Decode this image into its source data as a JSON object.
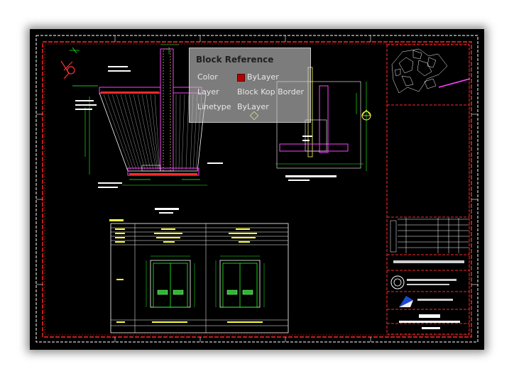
{
  "tooltip": {
    "title": "Block Reference",
    "rows": [
      {
        "label": "Color",
        "value": "ByLayer"
      },
      {
        "label": "Layer",
        "value": "Block Kop Border"
      },
      {
        "label": "Linetype",
        "value": "ByLayer"
      }
    ],
    "color_swatch": "#b00000"
  },
  "colors": {
    "background": "#000000",
    "border": "#ff2020",
    "frame": "#ffffff",
    "drawing_green": "#20ff20",
    "drawing_magenta": "#ff20ff",
    "drawing_cyan": "#00e0e0",
    "drawing_yellow": "#ffff40"
  },
  "icons": [
    "north-arrow-icon",
    "section-marker-icon",
    "company-logo-icon",
    "cursor-marker-icon"
  ]
}
